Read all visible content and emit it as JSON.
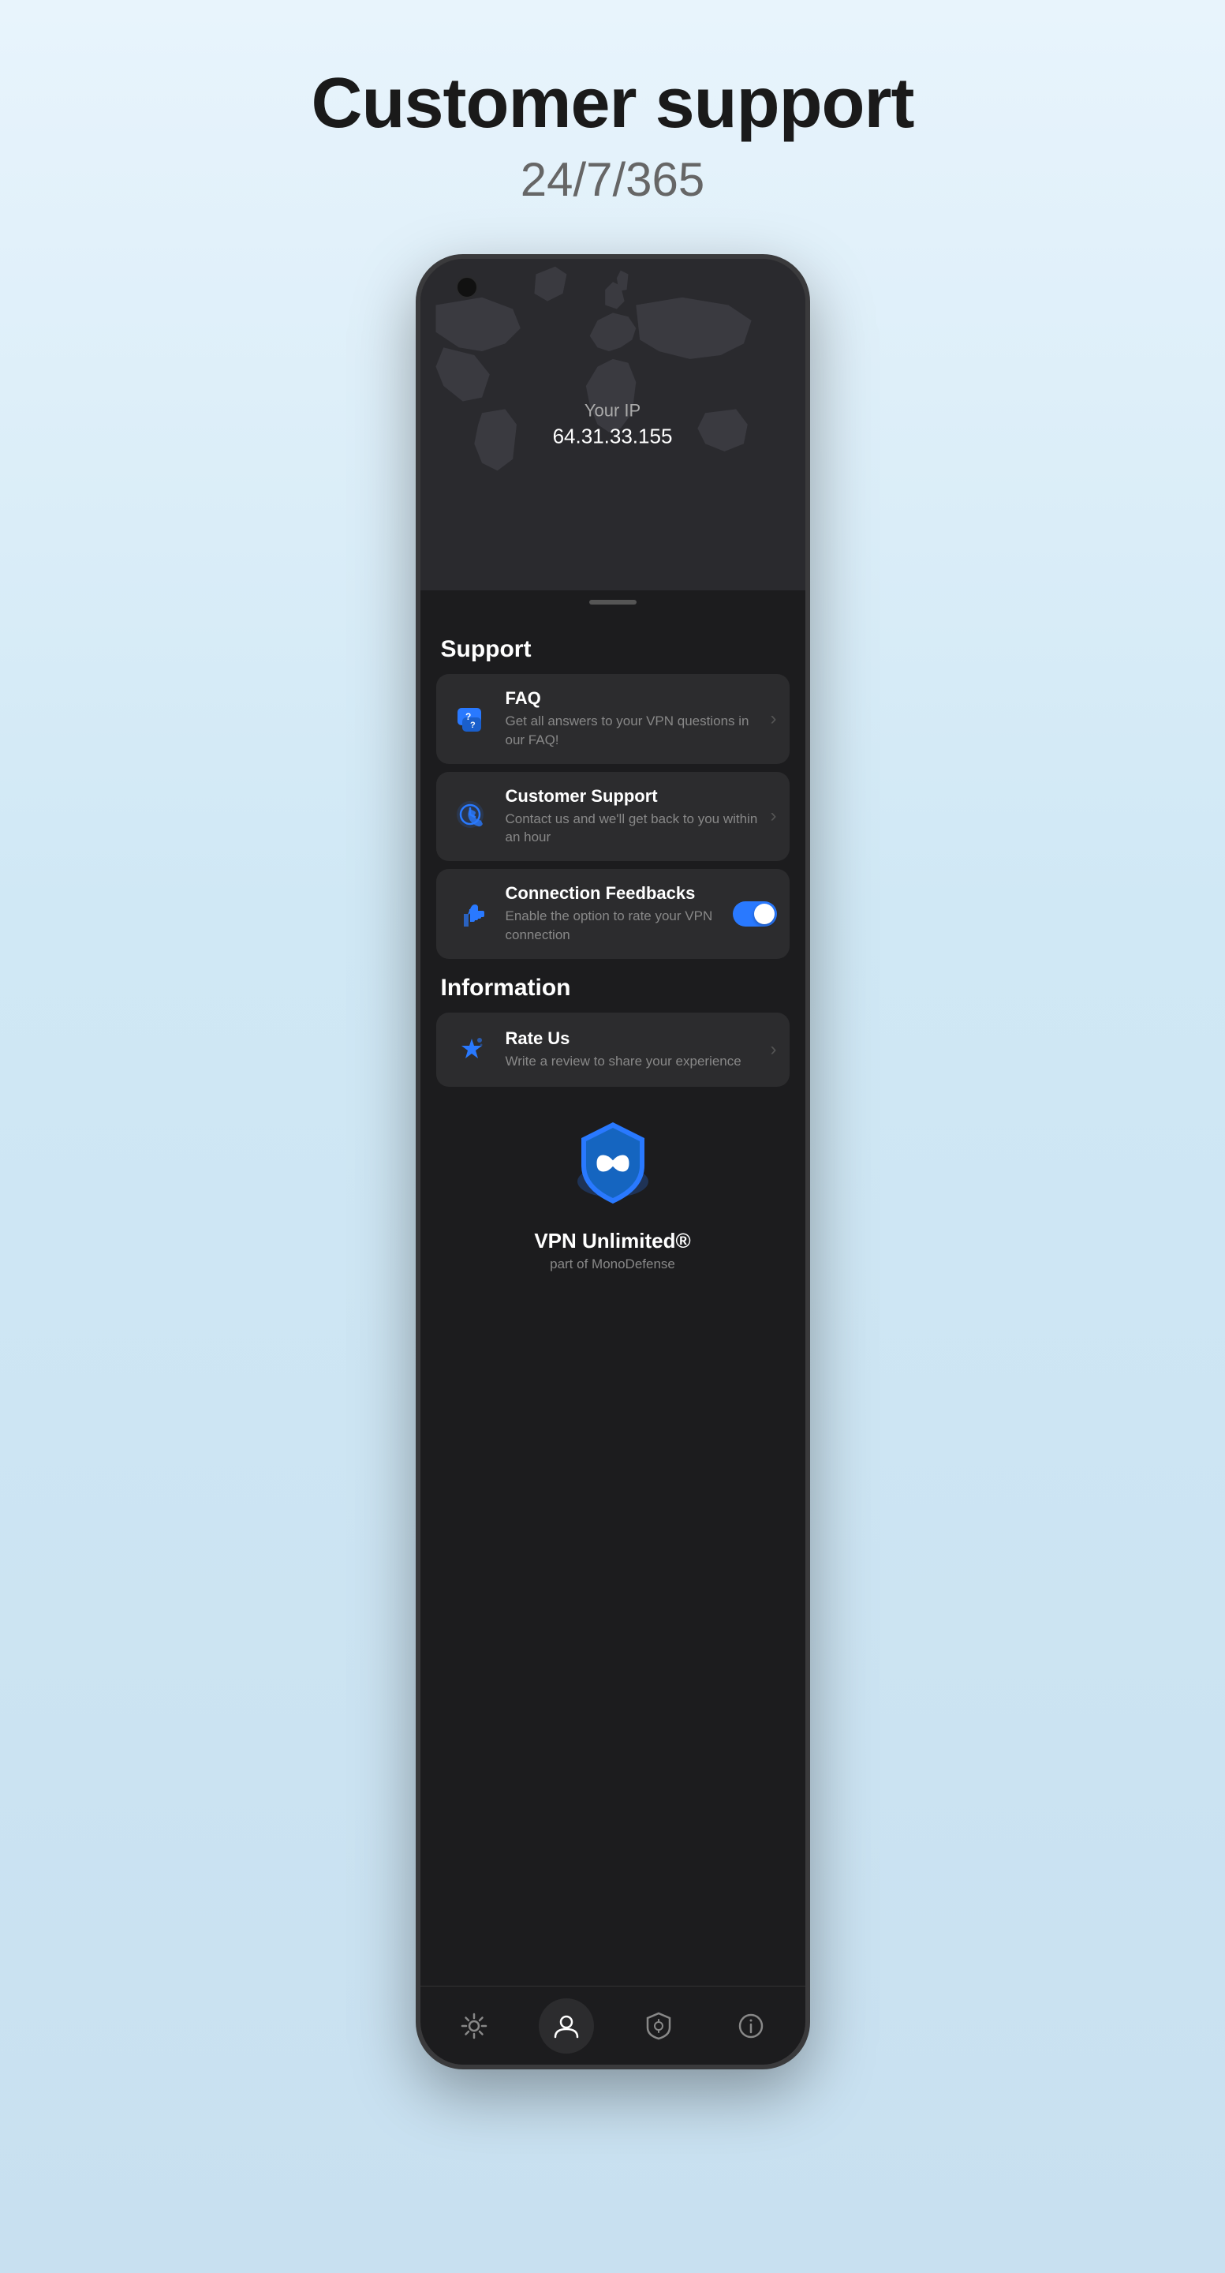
{
  "header": {
    "title": "Customer support",
    "subtitle": "24/7/365"
  },
  "phone": {
    "ip_label": "Your IP",
    "ip_address": "64.31.33.155"
  },
  "support_section": {
    "title": "Support",
    "items": [
      {
        "id": "faq",
        "title": "FAQ",
        "desc": "Get all answers to your VPN questions in our FAQ!",
        "type": "chevron"
      },
      {
        "id": "customer-support",
        "title": "Customer Support",
        "desc": "Contact us and we'll get back to you within an hour",
        "type": "chevron"
      },
      {
        "id": "connection-feedbacks",
        "title": "Connection Feedbacks",
        "desc": "Enable the option to rate your VPN connection",
        "type": "toggle"
      }
    ]
  },
  "information_section": {
    "title": "Information",
    "items": [
      {
        "id": "rate-us",
        "title": "Rate Us",
        "desc": "Write a review to share your experience",
        "type": "chevron"
      }
    ]
  },
  "branding": {
    "name": "VPN Unlimited®",
    "sub": "part of MonoDefense"
  },
  "nav": {
    "items": [
      {
        "id": "settings",
        "icon": "gear"
      },
      {
        "id": "account",
        "icon": "person"
      },
      {
        "id": "vpn",
        "icon": "vpn-shield"
      },
      {
        "id": "info",
        "icon": "info"
      }
    ]
  },
  "colors": {
    "accent": "#2979ff",
    "text_primary": "#ffffff",
    "text_secondary": "#888888",
    "bg_card": "#2c2c2e",
    "bg_screen": "#1c1c1e"
  }
}
